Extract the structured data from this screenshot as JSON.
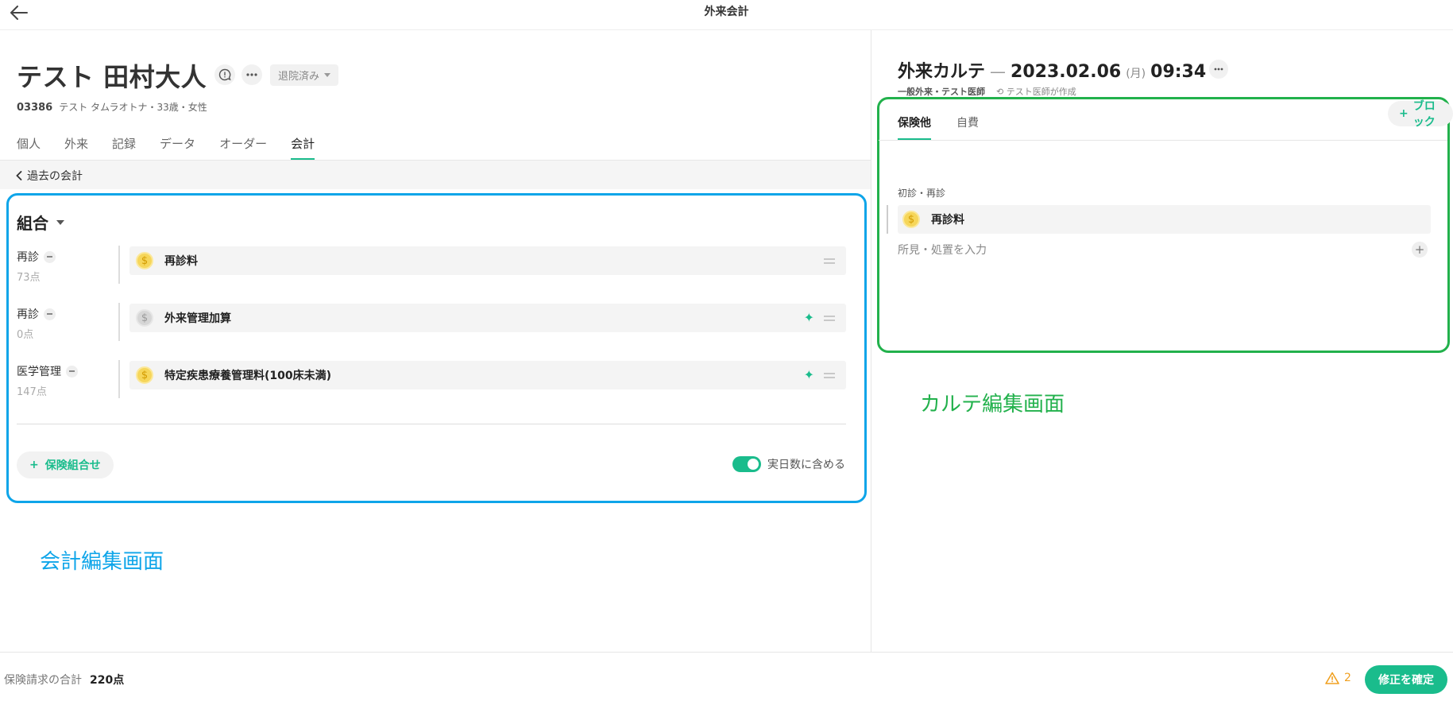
{
  "topbar": {
    "title": "外来会計"
  },
  "patient": {
    "name": "テスト 田村大人",
    "status": "退院済み",
    "id": "03386",
    "details": "テスト タムラオトナ・33歳・女性"
  },
  "tabs": [
    {
      "label": "個人",
      "active": false
    },
    {
      "label": "外来",
      "active": false
    },
    {
      "label": "記録",
      "active": false
    },
    {
      "label": "データ",
      "active": false
    },
    {
      "label": "オーダー",
      "active": false
    },
    {
      "label": "会計",
      "active": true
    }
  ],
  "past_link": "過去の会計",
  "combo": {
    "title": "組合",
    "rows": [
      {
        "category": "再診",
        "points": "73点",
        "item": "再診料",
        "coin": "yellow",
        "sparkle": false
      },
      {
        "category": "再診",
        "points": "0点",
        "item": "外来管理加算",
        "coin": "gray",
        "sparkle": true
      },
      {
        "category": "医学管理",
        "points": "147点",
        "item": "特定疾患療養管理料(100床未満)",
        "coin": "yellow",
        "sparkle": true
      }
    ],
    "add_insurance_label": "保険組合せ",
    "toggle_label": "実日数に含める",
    "toggle_on": true
  },
  "annotations": {
    "blue_label": "会計編集画面",
    "green_label": "カルテ編集画面"
  },
  "karte": {
    "title": "外来カルテ",
    "date": "2023.02.06",
    "weekday": "(月)",
    "time": "09:34",
    "dept": "一般外来・テスト医師",
    "author": "テスト医師が作成",
    "tabs": [
      {
        "label": "保険他",
        "active": true
      },
      {
        "label": "自費",
        "active": false
      }
    ],
    "add_block_label": "ブロック",
    "section_label": "初診・再診",
    "item": "再診料",
    "finding_placeholder": "所見・処置を入力"
  },
  "footer": {
    "total_label": "保険請求の合計",
    "total_value": "220点",
    "warning_count": "2",
    "confirm_label": "修正を確定"
  },
  "colors": {
    "accent": "#1abc8c",
    "annot_blue": "#0ea5e9",
    "annot_green": "#22b14c",
    "warning": "#f0a020"
  }
}
